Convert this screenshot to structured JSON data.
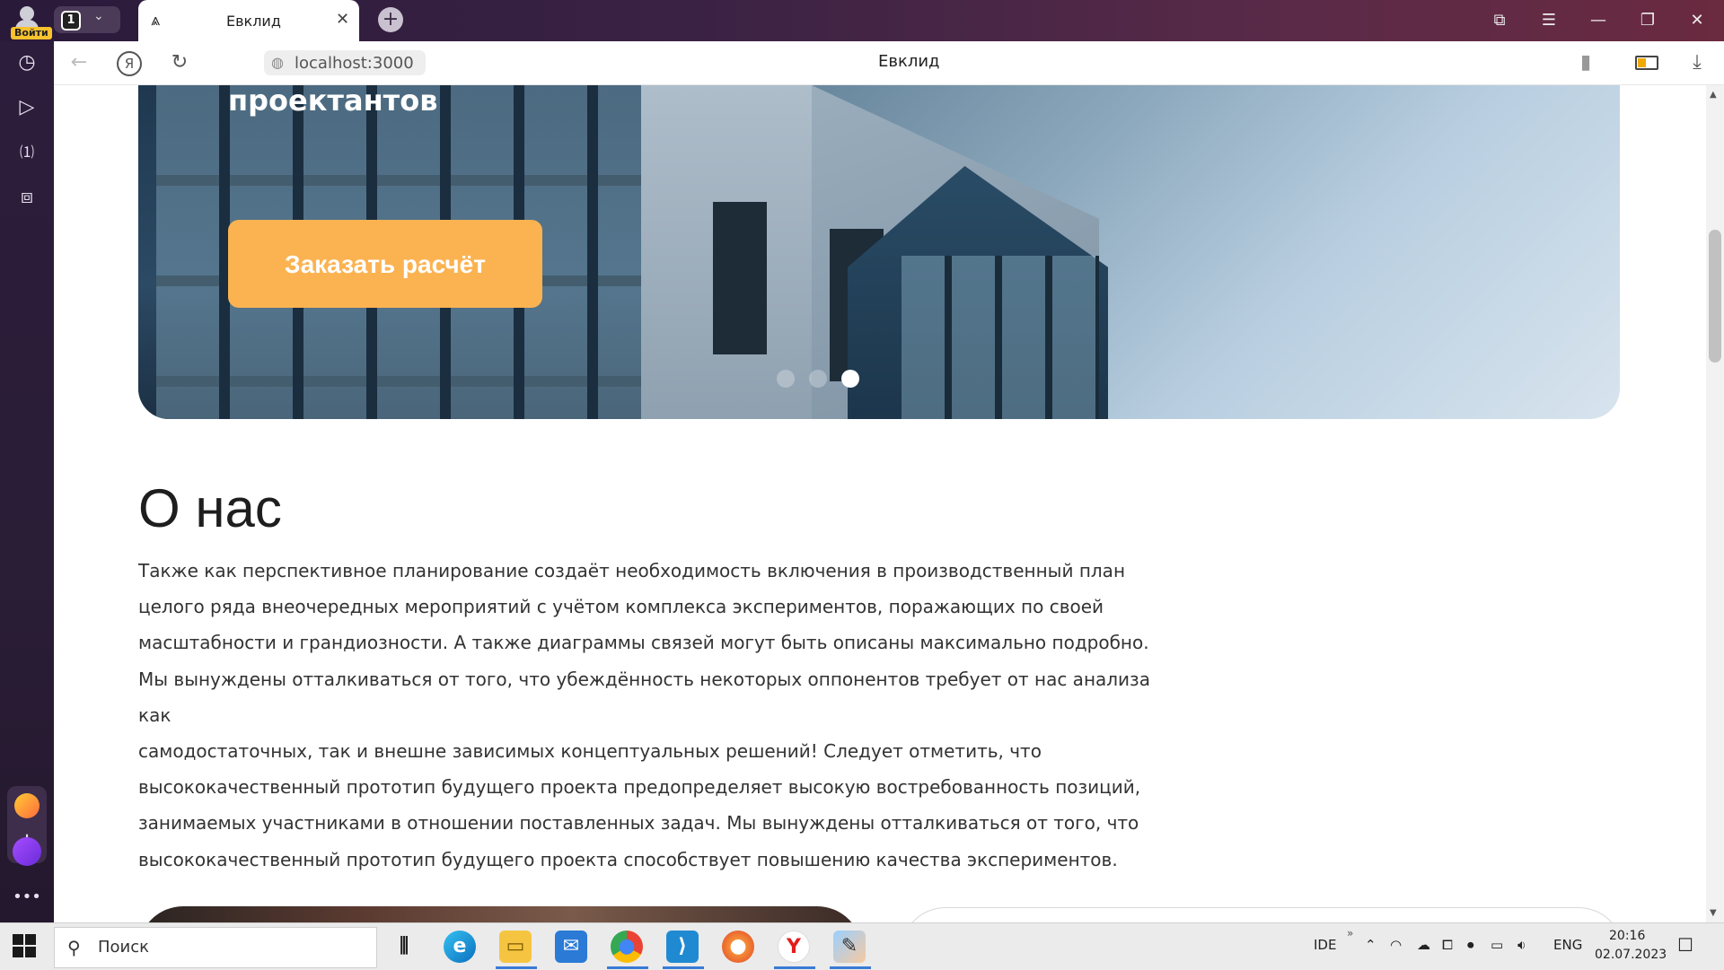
{
  "browser": {
    "login_label": "Войти",
    "tab_count": "1",
    "tab_title": "Евклид",
    "url": "localhost:3000",
    "page_title": "Евклид",
    "yandex_label": "Я"
  },
  "hero": {
    "heading_fragment": "проектантов",
    "cta_label": "Заказать расчёт",
    "slide_count": 3,
    "active_slide": 3
  },
  "about": {
    "heading": "О нас",
    "lines": [
      "Также как перспективное планирование создаёт необходимость включения в производственный план",
      "целого ряда внеочередных мероприятий с учётом комплекса экспериментов, поражающих по своей",
      "масштабности и грандиозности. А также диаграммы связей могут быть описаны максимально подробно.",
      "Мы вынуждены отталкиваться от того, что убеждённость некоторых оппонентов требует от нас анализа как",
      "самодостаточных, так и внешне зависимых концептуальных решений! Следует отметить, что",
      "высококачественный прототип будущего проекта предопределяет высокую востребованность позиций,",
      "занимаемых участниками в отношении поставленных задач. Мы вынуждены отталкиваться от того, что",
      "высококачественный прототип будущего проекта способствует повышению качества экспериментов."
    ]
  },
  "taskbar": {
    "search_placeholder": "Поиск",
    "ime": "IDE",
    "language": "ENG",
    "time": "20:16",
    "date": "02.07.2023"
  },
  "colors": {
    "cta": "#fbb351",
    "text": "#333333",
    "heading": "#1e1e1e"
  }
}
